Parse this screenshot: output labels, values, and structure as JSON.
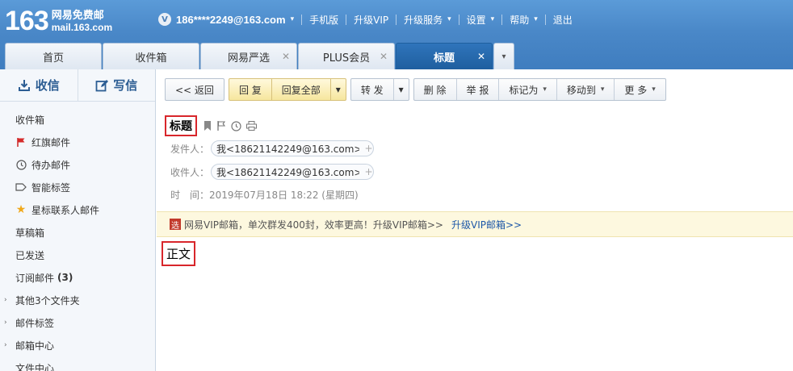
{
  "logo": {
    "number": "163",
    "name": "网易免费邮",
    "domain": "mail.163.com"
  },
  "topnav": {
    "vip_badge": "V",
    "account": "186****2249@163.com",
    "links": [
      "手机版",
      "升级VIP",
      "升级服务",
      "设置",
      "帮助",
      "退出"
    ]
  },
  "tabs": [
    {
      "label": "首页"
    },
    {
      "label": "收件箱"
    },
    {
      "label": "网易严选"
    },
    {
      "label": "PLUS会员"
    },
    {
      "label": "标题"
    }
  ],
  "sidebar": {
    "receive_label": "收信",
    "write_label": "写信",
    "folders": [
      {
        "label": "收件箱"
      },
      {
        "label": "红旗邮件"
      },
      {
        "label": "待办邮件"
      },
      {
        "label": "智能标签"
      },
      {
        "label": "星标联系人邮件"
      },
      {
        "label": "草稿箱"
      },
      {
        "label": "已发送"
      },
      {
        "label": "订阅邮件",
        "count": "(3)"
      },
      {
        "label": "其他3个文件夹"
      },
      {
        "label": "邮件标签"
      },
      {
        "label": "邮箱中心"
      },
      {
        "label": "文件中心"
      }
    ]
  },
  "toolbar": {
    "back": "<< 返回",
    "reply": "回 复",
    "reply_all": "回复全部",
    "forward": "转 发",
    "delete": "删 除",
    "report": "举 报",
    "mark_as": "标记为",
    "move_to": "移动到",
    "more": "更 多"
  },
  "mail": {
    "subject": "标题",
    "from_label": "发件人：",
    "from_value": "我<18621142249@163.com>",
    "to_label": "收件人：",
    "to_value": "我<18621142249@163.com>",
    "time_label": "时　间：",
    "time_value": "2019年07月18日 18:22 (星期四)",
    "body": "正文"
  },
  "vip_bar": {
    "tag": "选",
    "text": "网易VIP邮箱，单次群发400封，效率更高！升级VIP邮箱>>",
    "link": "升级VIP邮箱>>"
  },
  "colors": {
    "header": "#4a88c8",
    "active_tab": "#2f74bb",
    "highlight_border": "#d8262b",
    "link": "#1e58a8"
  }
}
